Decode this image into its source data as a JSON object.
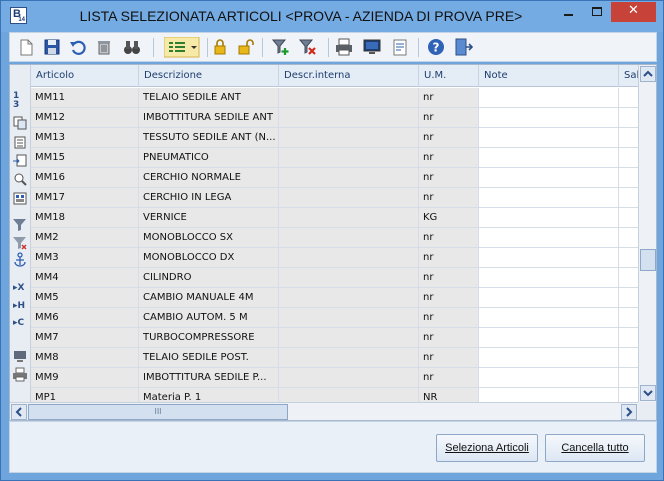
{
  "window": {
    "title": "LISTA SELEZIONATA ARTICOLI <PROVA - AZIENDA DI PROVA PRE>",
    "app_icon_letter": "B",
    "app_icon_number": "14",
    "close_glyph": "✕"
  },
  "toolbar": {
    "icons": [
      "new-document-icon",
      "save-icon",
      "undo-icon",
      "delete-icon",
      "binoculars-icon",
      "columns-dropdown-icon",
      "lock-icon",
      "unlock-icon",
      "filter-add-icon",
      "filter-remove-icon",
      "print-icon",
      "monitor-preview-icon",
      "export-icon",
      "help-icon",
      "exit-icon"
    ]
  },
  "sidebar": {
    "sort_label": "1\n3",
    "x_label": "X",
    "h_label": "H",
    "c_label": "C"
  },
  "grid": {
    "columns": [
      "Articolo",
      "Descrizione",
      "Descr.interna",
      "U.M.",
      "Note",
      "Sal"
    ],
    "rows": [
      {
        "articolo": "MM11",
        "descrizione": "TELAIO SEDILE ANT",
        "descr_interna": "",
        "um": "nr",
        "note": ""
      },
      {
        "articolo": "MM12",
        "descrizione": "IMBOTTITURA SEDILE ANT",
        "descr_interna": "",
        "um": "nr",
        "note": ""
      },
      {
        "articolo": "MM13",
        "descrizione": "TESSUTO SEDILE ANT (N...",
        "descr_interna": "",
        "um": "nr",
        "note": ""
      },
      {
        "articolo": "MM15",
        "descrizione": "PNEUMATICO",
        "descr_interna": "",
        "um": "nr",
        "note": ""
      },
      {
        "articolo": "MM16",
        "descrizione": "CERCHIO NORMALE",
        "descr_interna": "",
        "um": "nr",
        "note": ""
      },
      {
        "articolo": "MM17",
        "descrizione": "CERCHIO IN LEGA",
        "descr_interna": "",
        "um": "nr",
        "note": ""
      },
      {
        "articolo": "MM18",
        "descrizione": "VERNICE",
        "descr_interna": "",
        "um": "KG",
        "note": ""
      },
      {
        "articolo": "MM2",
        "descrizione": "MONOBLOCCO SX",
        "descr_interna": "",
        "um": "nr",
        "note": ""
      },
      {
        "articolo": "MM3",
        "descrizione": "MONOBLOCCO DX",
        "descr_interna": "",
        "um": "nr",
        "note": ""
      },
      {
        "articolo": "MM4",
        "descrizione": "CILINDRO",
        "descr_interna": "",
        "um": "nr",
        "note": ""
      },
      {
        "articolo": "MM5",
        "descrizione": "CAMBIO MANUALE 4M",
        "descr_interna": "",
        "um": "nr",
        "note": ""
      },
      {
        "articolo": "MM6",
        "descrizione": "CAMBIO AUTOM. 5 M",
        "descr_interna": "",
        "um": "nr",
        "note": ""
      },
      {
        "articolo": "MM7",
        "descrizione": "TURBOCOMPRESSORE",
        "descr_interna": "",
        "um": "nr",
        "note": ""
      },
      {
        "articolo": "MM8",
        "descrizione": "TELAIO SEDILE POST.",
        "descr_interna": "",
        "um": "nr",
        "note": ""
      },
      {
        "articolo": "MM9",
        "descrizione": "IMBOTTITURA SEDILE P...",
        "descr_interna": "",
        "um": "nr",
        "note": ""
      },
      {
        "articolo": "MP1",
        "descrizione": "Materia P. 1",
        "descr_interna": "",
        "um": "NR",
        "note": ""
      }
    ]
  },
  "hscroll": {
    "thumb_glyph": "III"
  },
  "buttons": {
    "seleziona": "Seleziona Articoli",
    "cancella": "Cancella tutto"
  },
  "colors": {
    "titlebar": "#74abe2",
    "close": "#c7433a",
    "grey_cell": "#e8e8e8",
    "header": "#e4ecf6"
  }
}
